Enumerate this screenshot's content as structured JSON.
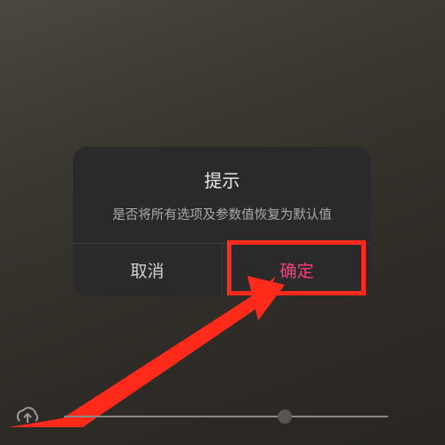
{
  "dialog": {
    "title": "提示",
    "message": "是否将所有选项及参数值恢复为默认值",
    "cancel_label": "取消",
    "confirm_label": "确定"
  },
  "icons": {
    "upload": "upload-cloud-icon"
  },
  "slider": {
    "position_pct": 68
  },
  "colors": {
    "highlight": "#ff2a1a",
    "confirm_text": "#ff3b7f"
  },
  "annotation": {
    "type": "arrow",
    "target": "confirm-button"
  }
}
